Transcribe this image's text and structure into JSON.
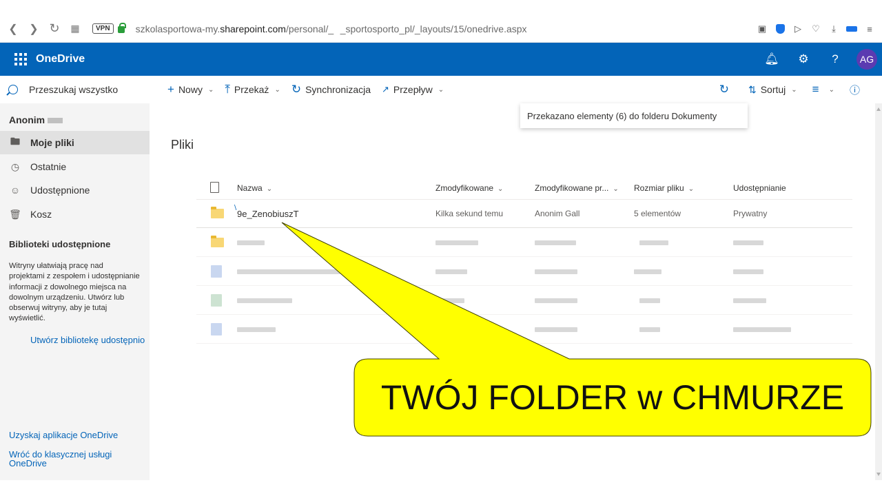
{
  "browser": {
    "url_prefix": "szkolasportowa-my.",
    "url_host": "sharepoint.com",
    "url_path": "/personal/_   _sportosporto_pl/_layouts/15/onedrive.aspx",
    "vpn_label": "VPN"
  },
  "suite": {
    "app_name": "OneDrive",
    "avatar_initials": "AG",
    "accent": "#0364b8"
  },
  "commandbar": {
    "search_placeholder": "Przeszukaj wszystko",
    "new_label": "Nowy",
    "upload_label": "Przekaż",
    "sync_label": "Synchronizacja",
    "flow_label": "Przepływ",
    "sort_label": "Sortuj"
  },
  "leftnav": {
    "user": "Anonim",
    "items": [
      {
        "label": "Moje pliki",
        "icon": "folder-icon"
      },
      {
        "label": "Ostatnie",
        "icon": "clock-icon"
      },
      {
        "label": "Udostępnione",
        "icon": "people-icon"
      },
      {
        "label": "Kosz",
        "icon": "trash-icon"
      }
    ],
    "shared_heading": "Biblioteki udostępnione",
    "shared_desc": "Witryny ułatwiają pracę nad projektami z zespołem i udostępnianie informacji z dowolnego miejsca na dowolnym urządzeniu. Utwórz lub obserwuj witryny, aby je tutaj wyświetlić.",
    "create_library_link": "Utwórz bibliotekę udostępnio",
    "get_app_link": "Uzyskaj aplikacje OneDrive",
    "classic_link": "Wróć do klasycznej usługi OneDrive"
  },
  "main": {
    "notification": "Przekazano elementy (6) do folderu Dokumenty",
    "title": "Pliki",
    "columns": [
      "Nazwa",
      "Zmodyfikowane",
      "Zmodyfikowane pr...",
      "Rozmiar pliku",
      "Udostępnianie"
    ],
    "first_row": {
      "name": "9e_ZenobiuszT",
      "modified": "Kilka sekund temu",
      "modified_by": "Anonim Gall",
      "size": "5 elementów",
      "sharing": "Prywatny"
    }
  },
  "callout": {
    "text": "TWÓJ FOLDER w CHMURZE",
    "fill": "#ffff00"
  }
}
